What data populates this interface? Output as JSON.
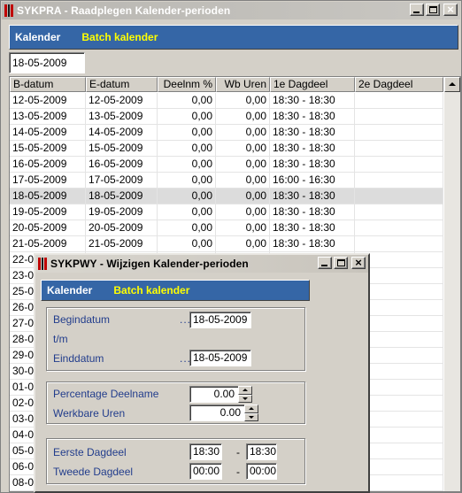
{
  "main": {
    "title": "SYKPRA - Raadplegen Kalender-perioden",
    "menu": {
      "item1": "Kalender",
      "item2": "Batch kalender"
    },
    "date_filter": "18-05-2009",
    "columns": [
      "B-datum",
      "E-datum",
      "Deelnm %",
      "Wb Uren",
      "1e Dagdeel",
      "2e Dagdeel"
    ],
    "rows": [
      [
        "12-05-2009",
        "12-05-2009",
        "0,00",
        "0,00",
        "18:30 - 18:30",
        ""
      ],
      [
        "13-05-2009",
        "13-05-2009",
        "0,00",
        "0,00",
        "18:30 - 18:30",
        ""
      ],
      [
        "14-05-2009",
        "14-05-2009",
        "0,00",
        "0,00",
        "18:30 - 18:30",
        ""
      ],
      [
        "15-05-2009",
        "15-05-2009",
        "0,00",
        "0,00",
        "18:30 - 18:30",
        ""
      ],
      [
        "16-05-2009",
        "16-05-2009",
        "0,00",
        "0,00",
        "18:30 - 18:30",
        ""
      ],
      [
        "17-05-2009",
        "17-05-2009",
        "0,00",
        "0,00",
        "16:00 - 16:30",
        ""
      ],
      [
        "18-05-2009",
        "18-05-2009",
        "0,00",
        "0,00",
        "18:30 - 18:30",
        ""
      ],
      [
        "19-05-2009",
        "19-05-2009",
        "0,00",
        "0,00",
        "18:30 - 18:30",
        ""
      ],
      [
        "20-05-2009",
        "20-05-2009",
        "0,00",
        "0,00",
        "18:30 - 18:30",
        ""
      ],
      [
        "21-05-2009",
        "21-05-2009",
        "0,00",
        "0,00",
        "18:30 - 18:30",
        ""
      ],
      [
        "22-0",
        "",
        "",
        "",
        "",
        ""
      ],
      [
        "23-0",
        "",
        "",
        "",
        "",
        ""
      ],
      [
        "25-0",
        "",
        "",
        "",
        "",
        ""
      ],
      [
        "26-0",
        "",
        "",
        "",
        "",
        ""
      ],
      [
        "27-0",
        "",
        "",
        "",
        "",
        ""
      ],
      [
        "28-0",
        "",
        "",
        "",
        "",
        ""
      ],
      [
        "29-0",
        "",
        "",
        "",
        "",
        ""
      ],
      [
        "30-0",
        "",
        "",
        "",
        "",
        ""
      ],
      [
        "01-0",
        "",
        "",
        "",
        "",
        ""
      ],
      [
        "02-0",
        "",
        "",
        "",
        "",
        ""
      ],
      [
        "03-0",
        "",
        "",
        "",
        "",
        ""
      ],
      [
        "04-0",
        "",
        "",
        "",
        "",
        ""
      ],
      [
        "05-0",
        "",
        "",
        "",
        "",
        ""
      ],
      [
        "06-0",
        "",
        "",
        "",
        "",
        ""
      ],
      [
        "08-0",
        "",
        "",
        "",
        "",
        ""
      ]
    ],
    "selected_row": 6
  },
  "dialog": {
    "title": "SYKPWY - Wijzigen Kalender-perioden",
    "menu": {
      "item1": "Kalender",
      "item2": "Batch kalender"
    },
    "begindatum_label": "Begindatum",
    "tm_label": "t/m",
    "einddatum_label": "Einddatum",
    "begindatum": "18-05-2009",
    "einddatum": "18-05-2009",
    "percentage_label": "Percentage Deelname",
    "werkbare_label": "Werkbare Uren",
    "percentage": "0.00",
    "werkbare": "0.00",
    "eerste_label": "Eerste Dagdeel",
    "tweede_label": "Tweede Dagdeel",
    "eerste_van": "18:30",
    "eerste_tot": "18:30",
    "tweede_van": "00:00",
    "tweede_tot": "00:00",
    "dots": "...",
    "dash": "-"
  },
  "colors": {
    "menu_bg": "#3566a6",
    "menu_batch": "#ffff00",
    "label": "#223d8c",
    "selected_row": "#dcdcdc"
  }
}
